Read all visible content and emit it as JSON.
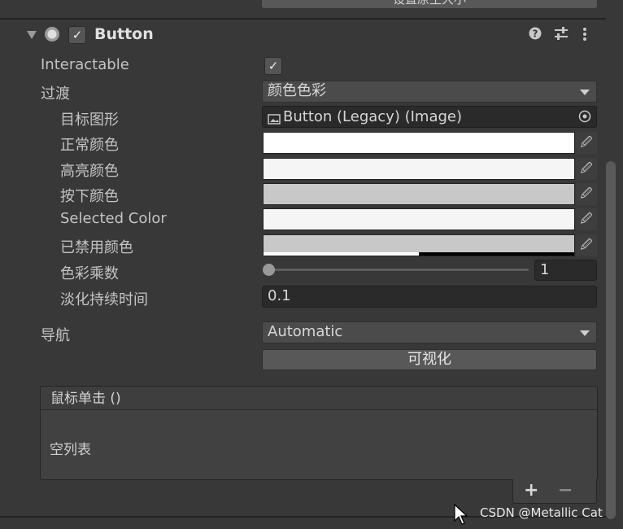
{
  "top_button": {
    "label": "设置原生大小"
  },
  "component": {
    "title": "Button",
    "help_icon": "question-circle-icon",
    "presets_icon": "sliders-icon",
    "menu_icon": "kebab-menu-icon"
  },
  "fields": {
    "interactable": {
      "label": "Interactable",
      "checked": true
    },
    "transition": {
      "label": "过渡",
      "value": "颜色色彩"
    },
    "target_graphic": {
      "label": "目标图形",
      "value": "Button (Legacy) (Image)"
    },
    "normal_color": {
      "label": "正常颜色",
      "color": "#ffffff"
    },
    "highlighted_color": {
      "label": "高亮颜色",
      "color": "#f5f5f5"
    },
    "pressed_color": {
      "label": "按下颜色",
      "color": "#c8c8c8"
    },
    "selected_color": {
      "label": "Selected Color",
      "color": "#f5f5f5"
    },
    "disabled_color": {
      "label": "已禁用颜色",
      "color": "#c8c8c8",
      "alpha_fraction": 0.5
    },
    "color_multiplier": {
      "label": "色彩乘数",
      "value": "1",
      "slider_fraction": 0.0
    },
    "fade_duration": {
      "label": "淡化持续时间",
      "value": "0.1"
    },
    "navigation": {
      "label": "导航",
      "value": "Automatic"
    },
    "visualize": {
      "label": "可视化"
    }
  },
  "on_click": {
    "header": "鼠标单击 ()",
    "empty_text": "空列表",
    "add_label": "+",
    "remove_label": "−"
  },
  "watermark": "CSDN @Metallic Cat"
}
